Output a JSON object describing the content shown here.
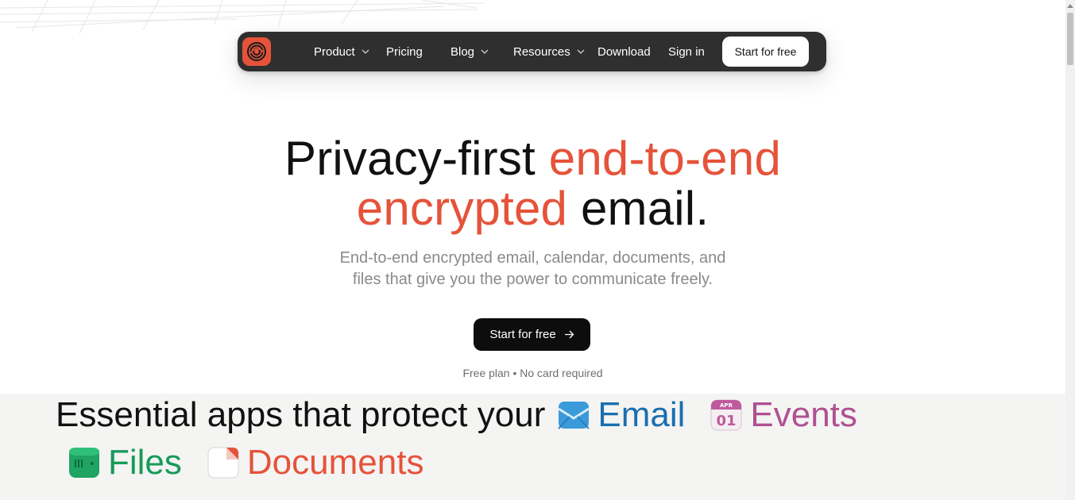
{
  "nav": {
    "items": [
      {
        "label": "Product",
        "dropdown": true
      },
      {
        "label": "Pricing",
        "dropdown": false
      },
      {
        "label": "Blog",
        "dropdown": true
      },
      {
        "label": "Resources",
        "dropdown": true
      },
      {
        "label": "Download",
        "dropdown": false
      },
      {
        "label": "Sign in",
        "dropdown": false
      }
    ],
    "cta": "Start for free"
  },
  "hero": {
    "title_part1": "Privacy-first ",
    "title_accent1": "end-to-end",
    "title_accent2": "encrypted",
    "title_part2": " email.",
    "subtitle_line1": "End-to-end encrypted email, calendar, documents, and",
    "subtitle_line2": "files that give you the power to communicate freely.",
    "cta": "Start for free",
    "note": "Free plan • No card required"
  },
  "apps": {
    "heading": "Essential apps that protect your",
    "email_label": "Email",
    "events_label": "Events",
    "events_icon_month": "APR",
    "events_icon_day": "01",
    "files_label": "Files",
    "documents_label": "Documents"
  },
  "colors": {
    "accent": "#e5533a",
    "nav_bg": "#2f2f2f",
    "email": "#1a6fae",
    "events": "#b05092",
    "files": "#179a5a"
  }
}
